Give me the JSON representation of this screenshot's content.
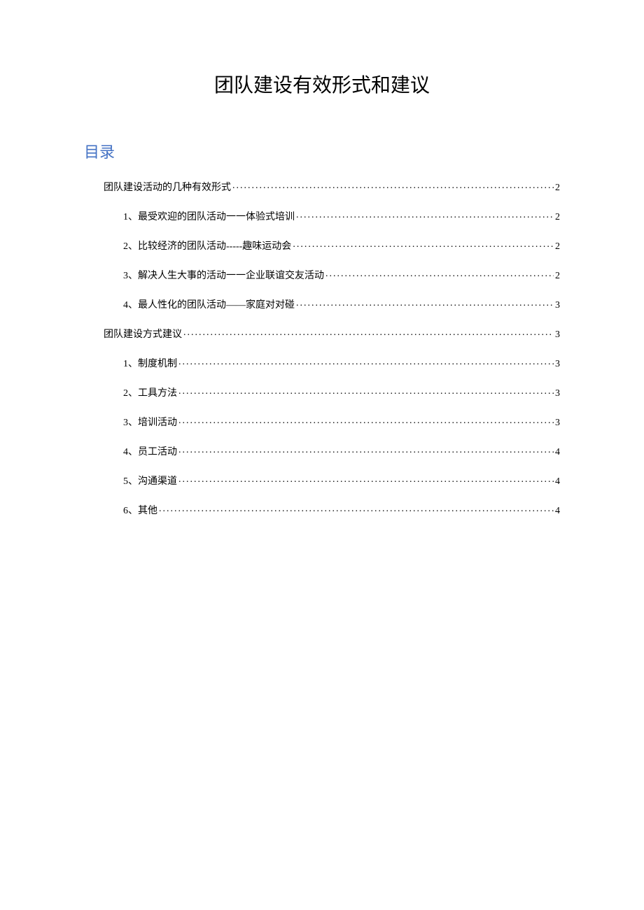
{
  "title": "团队建设有效形式和建议",
  "toc_heading": "目录",
  "toc": [
    {
      "level": 1,
      "label": "团队建设活动的几种有效形式",
      "page": "2"
    },
    {
      "level": 2,
      "label": "1、最受欢迎的团队活动一一体验式培训",
      "page": "2"
    },
    {
      "level": 2,
      "label": "2、比较经济的团队活动-----趣味运动会",
      "page": "2"
    },
    {
      "level": 2,
      "label": "3、解决人生大事的活动一一企业联谊交友活动",
      "page": "2"
    },
    {
      "level": 2,
      "label": "4、最人性化的团队活动——家庭对对碰",
      "page": "3"
    },
    {
      "level": 1,
      "label": "团队建设方式建议",
      "page": "3"
    },
    {
      "level": 2,
      "label": "1、制度机制",
      "page": "3"
    },
    {
      "level": 2,
      "label": "2、工具方法",
      "page": "3"
    },
    {
      "level": 2,
      "label": "3、培训活动",
      "page": "3"
    },
    {
      "level": 2,
      "label": "4、员工活动",
      "page": "4"
    },
    {
      "level": 2,
      "label": "5、沟通渠道",
      "page": "4"
    },
    {
      "level": 2,
      "label": "6、其他",
      "page": "4"
    }
  ]
}
